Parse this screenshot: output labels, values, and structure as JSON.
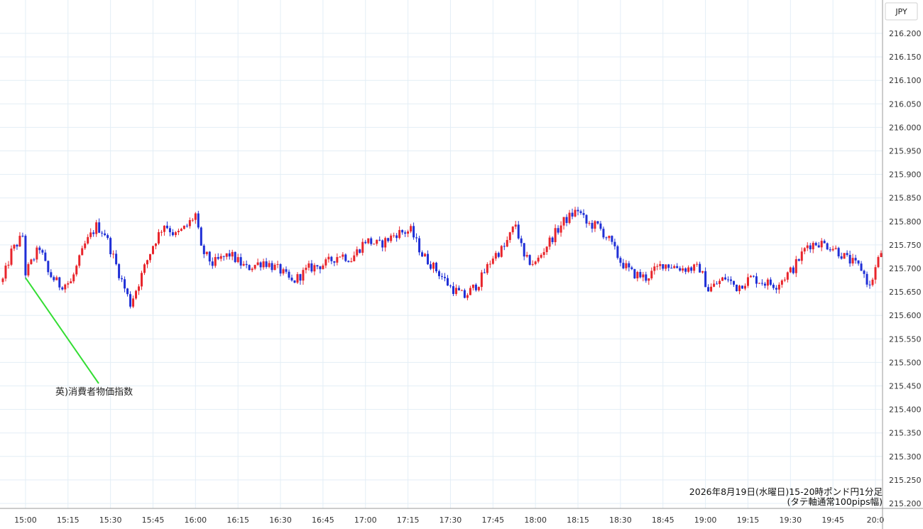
{
  "chart_data": {
    "type": "candlestick",
    "currency_label": "JPY",
    "caption_line1": "2026年8月19日(水曜日)15-20時ポンド円1分足",
    "caption_line2": "(タテ軸通常100pips幅)",
    "annotation": {
      "text": "英)消費者物価指数",
      "x": "15:00",
      "price": 215.68
    },
    "ylim": [
      215.2,
      216.2
    ],
    "y_ticks": [
      "216.200",
      "216.150",
      "216.100",
      "216.050",
      "216.000",
      "215.950",
      "215.900",
      "215.850",
      "215.800",
      "215.750",
      "215.700",
      "215.650",
      "215.600",
      "215.550",
      "215.500",
      "215.450",
      "215.400",
      "215.350",
      "215.300",
      "215.250",
      "215.200"
    ],
    "x_ticks": [
      "15:00",
      "15:15",
      "15:30",
      "15:45",
      "16:00",
      "16:15",
      "16:30",
      "16:45",
      "17:00",
      "17:15",
      "17:30",
      "17:45",
      "18:00",
      "18:15",
      "18:30",
      "18:45",
      "19:00",
      "19:15",
      "19:30",
      "19:45",
      "20:0"
    ],
    "x_start": "14:52",
    "x_end": "20:02",
    "colors": {
      "up": "#e8242b",
      "down": "#1f2fd6",
      "grid": "#e3eef6",
      "annotation_line": "#33dd33",
      "axis": "#999999"
    },
    "close_path": [
      [
        "14:52",
        215.675
      ],
      [
        "14:55",
        215.735
      ],
      [
        "14:59",
        215.77
      ],
      [
        "15:00",
        215.69
      ],
      [
        "15:05",
        215.745
      ],
      [
        "15:08",
        215.69
      ],
      [
        "15:12",
        215.665
      ],
      [
        "15:16",
        215.67
      ],
      [
        "15:21",
        215.75
      ],
      [
        "15:25",
        215.79
      ],
      [
        "15:28",
        215.775
      ],
      [
        "15:33",
        215.69
      ],
      [
        "15:37",
        215.625
      ],
      [
        "15:40",
        215.67
      ],
      [
        "15:45",
        215.75
      ],
      [
        "15:49",
        215.795
      ],
      [
        "15:53",
        215.77
      ],
      [
        "15:57",
        215.79
      ],
      [
        "16:00",
        215.815
      ],
      [
        "16:02",
        215.74
      ],
      [
        "16:06",
        215.71
      ],
      [
        "16:12",
        215.73
      ],
      [
        "16:18",
        215.7
      ],
      [
        "16:24",
        215.715
      ],
      [
        "16:30",
        215.695
      ],
      [
        "16:34",
        215.67
      ],
      [
        "16:40",
        215.7
      ],
      [
        "16:46",
        215.71
      ],
      [
        "16:51",
        215.73
      ],
      [
        "16:55",
        215.72
      ],
      [
        "17:00",
        215.76
      ],
      [
        "17:05",
        215.75
      ],
      [
        "17:11",
        215.775
      ],
      [
        "17:16",
        215.78
      ],
      [
        "17:20",
        215.73
      ],
      [
        "17:26",
        215.69
      ],
      [
        "17:30",
        215.66
      ],
      [
        "17:35",
        215.64
      ],
      [
        "17:40",
        215.67
      ],
      [
        "17:45",
        215.725
      ],
      [
        "17:49",
        215.745
      ],
      [
        "17:53",
        215.795
      ],
      [
        "17:56",
        215.72
      ],
      [
        "18:00",
        215.71
      ],
      [
        "18:04",
        215.75
      ],
      [
        "18:10",
        215.8
      ],
      [
        "18:15",
        215.825
      ],
      [
        "18:18",
        215.795
      ],
      [
        "18:22",
        215.79
      ],
      [
        "18:26",
        215.76
      ],
      [
        "18:30",
        215.715
      ],
      [
        "18:34",
        215.69
      ],
      [
        "18:39",
        215.68
      ],
      [
        "18:45",
        215.71
      ],
      [
        "18:52",
        215.7
      ],
      [
        "18:58",
        215.7
      ],
      [
        "19:01",
        215.655
      ],
      [
        "19:07",
        215.68
      ],
      [
        "19:11",
        215.66
      ],
      [
        "19:16",
        215.68
      ],
      [
        "19:21",
        215.67
      ],
      [
        "19:25",
        215.665
      ],
      [
        "19:31",
        215.7
      ],
      [
        "19:36",
        215.75
      ],
      [
        "19:40",
        215.755
      ],
      [
        "19:45",
        215.745
      ],
      [
        "19:50",
        215.72
      ],
      [
        "19:55",
        215.7
      ],
      [
        "19:58",
        215.66
      ],
      [
        "20:00",
        215.7
      ],
      [
        "20:02",
        215.735
      ]
    ]
  }
}
